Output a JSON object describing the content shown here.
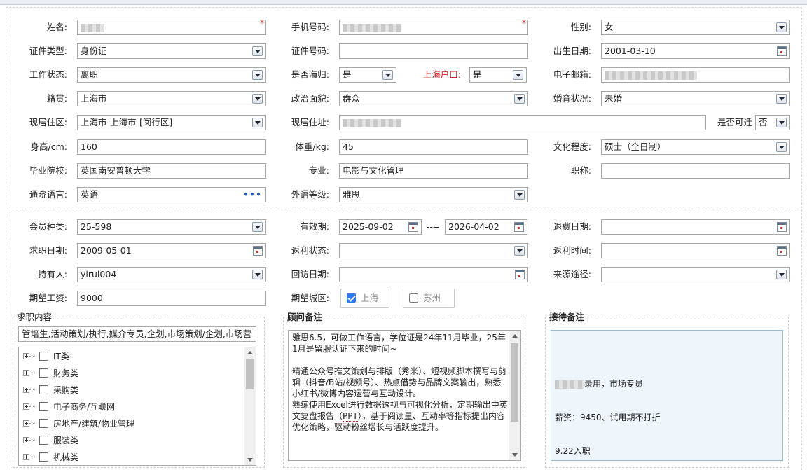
{
  "form": {
    "name": {
      "label": "姓名:"
    },
    "mobile": {
      "label": "手机号码:"
    },
    "gender": {
      "label": "性别:",
      "value": "女"
    },
    "id_type": {
      "label": "证件类型:",
      "value": "身份证"
    },
    "id_number": {
      "label": "证件号码:",
      "value": ""
    },
    "birth_date": {
      "label": "出生日期:",
      "value": "2001-03-10"
    },
    "work_status": {
      "label": "工作状态:",
      "value": "离职"
    },
    "returnee": {
      "label": "是否海归:",
      "value": "是"
    },
    "shanghai_hukou": {
      "label": "上海户口:",
      "value": "是"
    },
    "email": {
      "label": "电子邮箱:"
    },
    "native_place": {
      "label": "籍贯:",
      "value": "上海市"
    },
    "political": {
      "label": "政治面貌:",
      "value": "群众"
    },
    "marital": {
      "label": "婚育状况:",
      "value": "未婚"
    },
    "residence_area": {
      "label": "现居住区:",
      "value": "上海市-上海市-[闵行区]"
    },
    "residence_addr": {
      "label": "现居住址:"
    },
    "relocate": {
      "label": "是否可迁",
      "value": "否"
    },
    "height": {
      "label": "身高/cm:",
      "value": "160"
    },
    "weight": {
      "label": "体重/kg:",
      "value": "45"
    },
    "education": {
      "label": "文化程度:",
      "value": "硕士（全日制）"
    },
    "school": {
      "label": "毕业院校:",
      "value": "英国南安普顿大学"
    },
    "major": {
      "label": "专业:",
      "value": "电影与文化管理"
    },
    "title": {
      "label": "职称:",
      "value": ""
    },
    "language": {
      "label": "通晓语言:",
      "value": "英语"
    },
    "lang_level": {
      "label": "外语等级:",
      "value": "雅思"
    },
    "member_type": {
      "label": "会员种类:",
      "value": "25-598"
    },
    "valid_period": {
      "label": "有效期:",
      "from": "2025-09-02",
      "sep": "----",
      "to": "2026-04-02"
    },
    "refund_date": {
      "label": "退费日期:",
      "value": ""
    },
    "job_date": {
      "label": "求职日期:",
      "value": "2009-05-01"
    },
    "rebate_status": {
      "label": "返利状态:",
      "value": ""
    },
    "rebate_time": {
      "label": "返利时间:",
      "value": ""
    },
    "holder": {
      "label": "持有人:",
      "value": "yirui004"
    },
    "visit_date": {
      "label": "回访日期:",
      "value": ""
    },
    "source": {
      "label": "来源途径:",
      "value": ""
    },
    "salary": {
      "label": "期望工资:",
      "value": "9000"
    },
    "city": {
      "label": "期望城区:",
      "options": [
        {
          "label": "上海",
          "checked": true
        },
        {
          "label": "苏州",
          "checked": false
        }
      ]
    }
  },
  "job_content": {
    "title": "求职内容",
    "summary": "管培生,活动策划/执行,媒介专员,企划,市场策划/企划,市场营",
    "categories": [
      "IT类",
      "财务类",
      "采购类",
      "电子商务/互联网",
      "房地产/建筑/物业管理",
      "服装类",
      "机械类"
    ]
  },
  "advisor_notes": {
    "title": "顾问备注",
    "text_1": "雅思6.5，可做工作语言，学位证是24年11月毕业，25年1月是留服认证下来的时间~\n\n精通公众号推文策划与排版（秀米）、短视频脚本撰写与剪辑（抖音/B站/视频号）、热点借势与品牌文案输出，熟悉小红书/微博内容运营与互动设计。\n熟练使用Excel进行数据透视与可视化分析，定期输出中英文复盘报告（",
    "text_ppt": "PPT",
    "text_2": "），基于阅读量、互动率等指标提出内容优化策略，驱动粉丝增长与活跃度提升。"
  },
  "reception_notes": {
    "title": "接待备注",
    "line1": "录用，市场专员",
    "line2": "薪资：9450、试用期不打折",
    "line3": "9.22入职"
  }
}
